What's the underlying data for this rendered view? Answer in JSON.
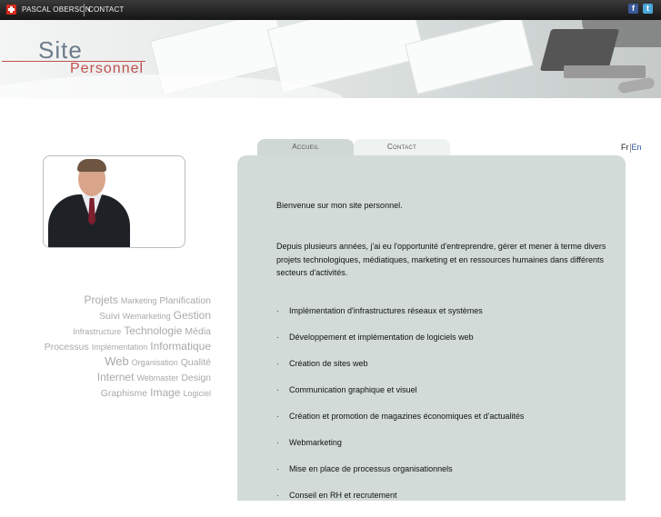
{
  "topbar": {
    "links": [
      "PASCAL OBERSON",
      "CONTACT"
    ],
    "social_icons": [
      "facebook-icon",
      "twitter-icon"
    ]
  },
  "banner": {
    "title_line1": "Site",
    "title_line2": "Personnel"
  },
  "tabs": [
    {
      "label": "Accueil",
      "active": true
    },
    {
      "label": "Contact",
      "active": false
    }
  ],
  "lang": {
    "fr": "Fr",
    "en": "En"
  },
  "tag_cloud": [
    [
      {
        "text": "Projets",
        "size": "s3"
      },
      {
        "text": "Marketing",
        "size": "s1"
      },
      {
        "text": "Planification",
        "size": "s2"
      }
    ],
    [
      {
        "text": "Suivi",
        "size": "s2"
      },
      {
        "text": "Wemarketing",
        "size": "s1"
      },
      {
        "text": "Gestion",
        "size": "s3"
      }
    ],
    [
      {
        "text": "Infrastructure",
        "size": "s1"
      },
      {
        "text": "Technologie",
        "size": "s3"
      },
      {
        "text": "Média",
        "size": "s2"
      }
    ],
    [
      {
        "text": "Processus",
        "size": "s2"
      },
      {
        "text": "Implémentation",
        "size": "s1"
      },
      {
        "text": "Informatique",
        "size": "s3"
      }
    ],
    [
      {
        "text": "Web",
        "size": "s4"
      },
      {
        "text": "Organisation",
        "size": "s1"
      },
      {
        "text": "Qualité",
        "size": "s2"
      }
    ],
    [
      {
        "text": "Internet",
        "size": "s3"
      },
      {
        "text": "Webmaster",
        "size": "s1"
      },
      {
        "text": "Design",
        "size": "s2"
      }
    ],
    [
      {
        "text": "Graphisme",
        "size": "s2"
      },
      {
        "text": "Image",
        "size": "s3"
      },
      {
        "text": "Logiciel",
        "size": "s1"
      }
    ]
  ],
  "content": {
    "welcome": "Bienvenue sur mon site personnel.",
    "intro": "Depuis plusieurs années, j'ai eu l'opportunité d'entreprendre, gérer et mener à terme divers projets technologiques, médiatiques, marketing et en ressources humaines dans différents secteurs d'activités.",
    "bullets": [
      "Implémentation d'infrastructures réseaux et systèmes",
      "Développement et implémentation de logiciels web",
      "Création de sites web",
      "Communication graphique et visuel",
      "Création et promotion de magazines économiques et d'actualités",
      "Webmarketing",
      "Mise en place de processus organisationnels",
      "Conseil en RH et recrutement"
    ],
    "bullet_symbol": "·"
  }
}
